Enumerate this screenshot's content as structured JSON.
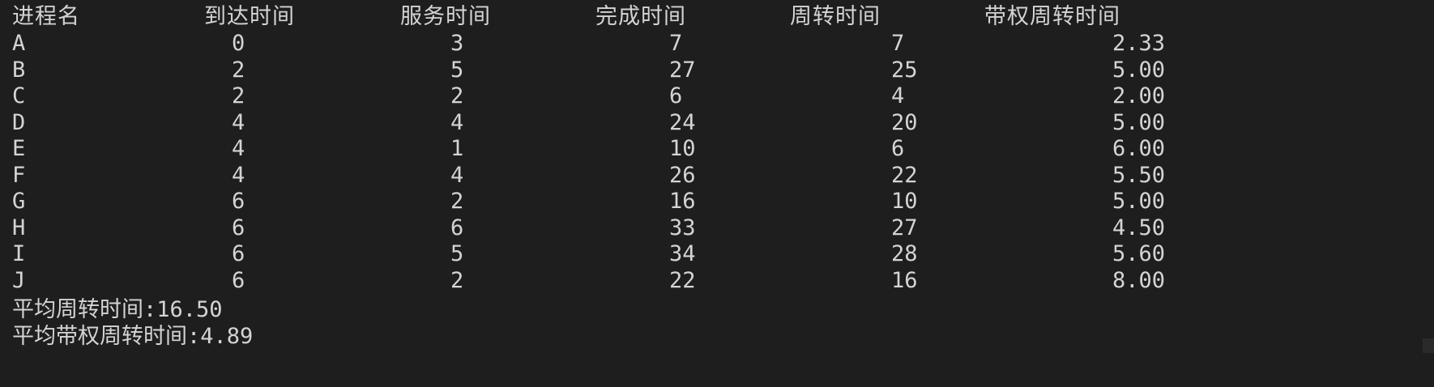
{
  "terminal": {
    "headers": [
      "进程名",
      "到达时间",
      "服务时间",
      "完成时间",
      "周转时间",
      "带权周转时间"
    ],
    "rows": [
      [
        "A",
        "0",
        "3",
        "7",
        "7",
        "2.33"
      ],
      [
        "B",
        "2",
        "5",
        "27",
        "25",
        "5.00"
      ],
      [
        "C",
        "2",
        "2",
        "6",
        "4",
        "2.00"
      ],
      [
        "D",
        "4",
        "4",
        "24",
        "20",
        "5.00"
      ],
      [
        "E",
        "4",
        "1",
        "10",
        "6",
        "6.00"
      ],
      [
        "F",
        "4",
        "4",
        "26",
        "22",
        "5.50"
      ],
      [
        "G",
        "6",
        "2",
        "16",
        "10",
        "5.00"
      ],
      [
        "H",
        "6",
        "6",
        "33",
        "27",
        "4.50"
      ],
      [
        "I",
        "6",
        "5",
        "34",
        "28",
        "5.60"
      ],
      [
        "J",
        "6",
        "2",
        "22",
        "16",
        "8.00"
      ]
    ],
    "summary": {
      "avg_turnaround": "平均周转时间:16.50",
      "avg_weighted_turnaround": "平均带权周转时间:4.89"
    }
  },
  "colors": {
    "background": "#1e1e1e",
    "text": "#d4d4d4"
  }
}
